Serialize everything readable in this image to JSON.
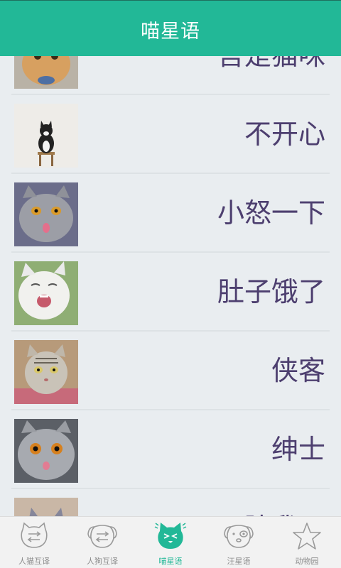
{
  "header": {
    "title": "喵星语"
  },
  "list": {
    "items": [
      {
        "label": "吾是猫咪",
        "thumb": "cat-orange-icon"
      },
      {
        "label": "不开心",
        "thumb": "cat-tuxedo-icon"
      },
      {
        "label": "小怒一下",
        "thumb": "cat-gray-tongue-icon"
      },
      {
        "label": "肚子饿了",
        "thumb": "cat-white-yawn-icon"
      },
      {
        "label": "侠客",
        "thumb": "cat-tabby-icon"
      },
      {
        "label": "绅士",
        "thumb": "cat-gray-face-icon"
      },
      {
        "label": "陪我玩",
        "thumb": "cat-gray-small-icon"
      }
    ]
  },
  "tabbar": {
    "tabs": [
      {
        "label": "人猫互译",
        "icon": "cat-swap-icon",
        "active": false
      },
      {
        "label": "人狗互译",
        "icon": "dog-swap-icon",
        "active": false
      },
      {
        "label": "喵星语",
        "icon": "cat-face-icon",
        "active": true
      },
      {
        "label": "汪星语",
        "icon": "dog-face-icon",
        "active": false
      },
      {
        "label": "动物园",
        "icon": "star-icon",
        "active": false
      }
    ]
  },
  "colors": {
    "accent": "#22b897",
    "label_text": "#4d3f6f",
    "background": "#e9edf0"
  }
}
